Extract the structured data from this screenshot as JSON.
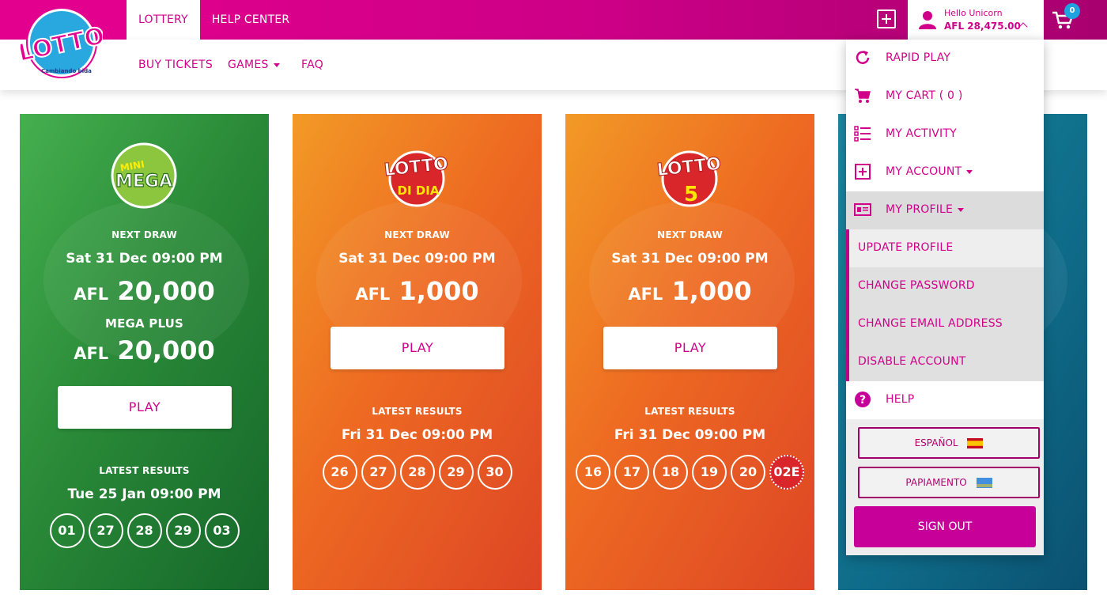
{
  "header": {
    "tabs": [
      {
        "label": "LOTTERY"
      },
      {
        "label": "HELP CENTER"
      }
    ],
    "user": {
      "greeting": "Hello Unicorn",
      "balance": "AFL 28,475.00"
    },
    "cart_count": "0",
    "icons": [
      "plus-square-icon",
      "user-icon",
      "chevron-up-icon",
      "cart-icon"
    ]
  },
  "logo": {
    "text": "LOTTO",
    "tagline": "Cambiando bida"
  },
  "subnav": {
    "buy_tickets": "BUY TICKETS",
    "games": "GAMES",
    "faq": "FAQ"
  },
  "cards": [
    {
      "logo_text_top": "MINI",
      "logo_text_main": "MEGA",
      "next_draw_label": "NEXT DRAW",
      "next_draw_date": "Sat 31 Dec 09:00 PM",
      "currency": "AFL",
      "jackpot": "20,000",
      "mega_plus_label": "MEGA PLUS",
      "mega_plus_currency": "AFL",
      "mega_plus_jackpot": "20,000",
      "play_label": "PLAY",
      "results_label": "LATEST RESULTS",
      "results_date": "Tue 25 Jan 09:00 PM",
      "balls": [
        "01",
        "27",
        "28",
        "29",
        "03"
      ]
    },
    {
      "logo_text_main": "LOTTO",
      "logo_text_sub": "DI DIA",
      "next_draw_label": "NEXT DRAW",
      "next_draw_date": "Sat 31 Dec 09:00 PM",
      "currency": "AFL",
      "jackpot": "1,000",
      "play_label": "PLAY",
      "results_label": "LATEST RESULTS",
      "results_date": "Fri 31 Dec 09:00 PM",
      "balls": [
        "26",
        "27",
        "28",
        "29",
        "30"
      ]
    },
    {
      "logo_text_main": "LOTTO",
      "logo_text_sub": "5",
      "next_draw_label": "NEXT DRAW",
      "next_draw_date": "Sat 31 Dec 09:00 PM",
      "currency": "AFL",
      "jackpot": "1,000",
      "play_label": "PLAY",
      "results_label": "LATEST RESULTS",
      "results_date": "Fri 31 Dec 09:00 PM",
      "balls": [
        "16",
        "17",
        "18",
        "19",
        "20"
      ],
      "extra_ball": "02E"
    }
  ],
  "dropdown": {
    "items": [
      {
        "label": "RAPID PLAY",
        "icon": "refresh-icon"
      },
      {
        "label": "MY CART ( 0 )",
        "icon": "cart-icon"
      },
      {
        "label": "MY ACTIVITY",
        "icon": "list-icon"
      },
      {
        "label": "MY ACCOUNT",
        "icon": "plus-square-icon"
      },
      {
        "label": "MY PROFILE",
        "icon": "id-card-icon"
      }
    ],
    "profile_sub": [
      "UPDATE PROFILE",
      "CHANGE PASSWORD",
      "CHANGE EMAIL ADDRESS",
      "DISABLE ACCOUNT"
    ],
    "help": {
      "label": "HELP",
      "icon": "question-circle-icon"
    },
    "languages": [
      {
        "label": "ESPAÑOL",
        "flag": "spain-flag"
      },
      {
        "label": "PAPIAMENTO",
        "flag": "aruba-flag"
      }
    ],
    "sign_out": "SIGN OUT"
  },
  "colors": {
    "brand_pink": "#d1008a",
    "green_card": "#2a8a38",
    "orange_card": "#ee6a22",
    "blue_card": "#0e6a88",
    "badge_blue": "#1fa3e0"
  }
}
